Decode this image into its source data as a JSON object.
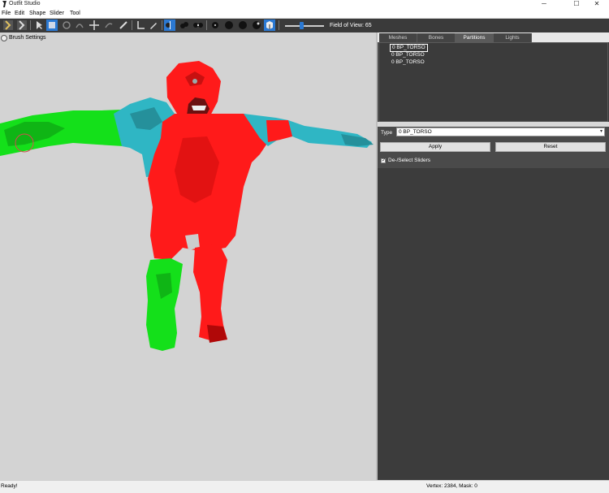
{
  "window": {
    "title": "Outfit Studio",
    "icon": "app-logo-icon",
    "controls": [
      "minimize-icon",
      "maximize-icon",
      "close-icon"
    ],
    "control_glyphs": {
      "minimize": "─",
      "maximize": "☐",
      "close": "✕"
    }
  },
  "menu": {
    "file": "File",
    "edit": "Edit",
    "shape": "Shape",
    "slider": "Slider",
    "tool": "Tool"
  },
  "toolbar": {
    "fov_label": "Field of View: 65",
    "fov_value": 65,
    "icons": [
      "load-reference-icon",
      "load-outfit-icon",
      "select-icon",
      "mask-brush-icon",
      "inflate-brush-icon",
      "deflate-brush-icon",
      "move-brush-icon",
      "smooth-brush-icon",
      "undiff-brush-icon",
      "weight-brush-icon",
      "color-brush-icon",
      "transform-icon",
      "pivot-icon",
      "mirror-view-icon",
      "wireframe-icon",
      "lighting-icon",
      "texture-icon",
      "mask-icon",
      "bones-icon",
      "vertex-icon",
      "segment-icon"
    ]
  },
  "viewport": {
    "brush_settings": "Brush Settings",
    "background": "#d3d3d3"
  },
  "tabs": [
    {
      "label": "Meshes",
      "active": false
    },
    {
      "label": "Bones",
      "active": false
    },
    {
      "label": "Partitions",
      "active": true
    },
    {
      "label": "Lights",
      "active": false
    }
  ],
  "partitions": [
    {
      "label": "0 BP_TORSO",
      "selected": true
    },
    {
      "label": "0 BP_TORSO",
      "selected": false
    },
    {
      "label": "0 BP_TORSO",
      "selected": false
    }
  ],
  "partition_props": {
    "type_label": "Type",
    "type_value": "0 BP_TORSO",
    "apply_label": "Apply",
    "reset_label": "Reset",
    "deselect_sliders_label": "De-/Select Sliders",
    "deselect_sliders_checked": true,
    "check_glyph": "✓"
  },
  "status": {
    "left": "Ready!",
    "right": "Vertex: 2384, Mask: 0"
  },
  "colors": {
    "accent": "#2b79d3",
    "panel_bg": "#3c3c3c",
    "toolbar_bg": "#3a3a3a",
    "partition_red": "#ff1a1a",
    "partition_green": "#14e01a",
    "partition_cyan": "#2fb6c4"
  }
}
